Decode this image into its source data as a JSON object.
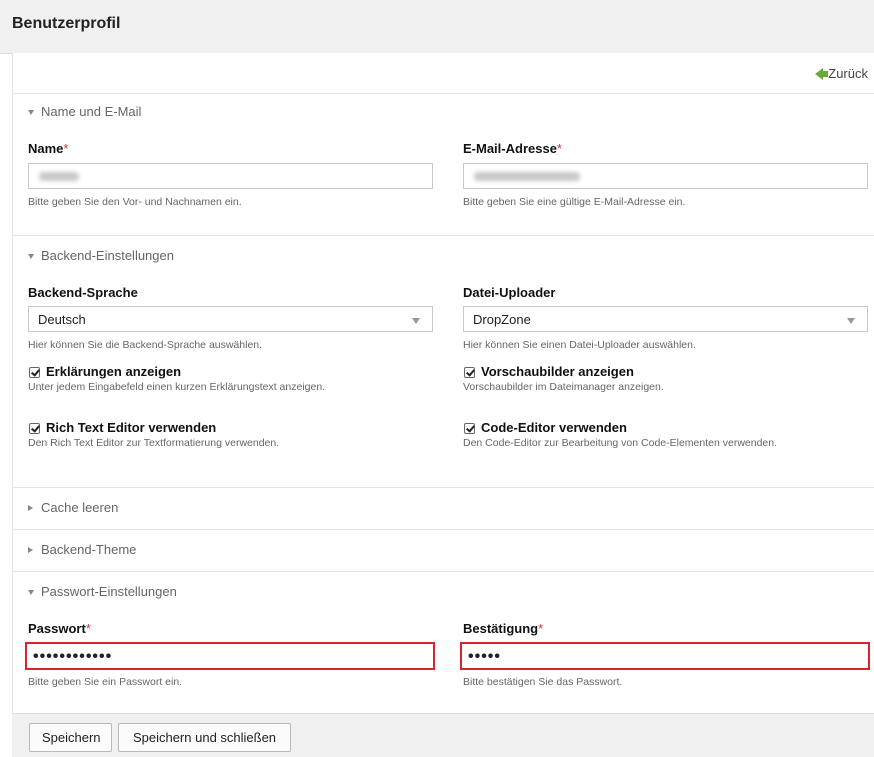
{
  "header": {
    "title": "Benutzerprofil"
  },
  "toolbar": {
    "back_label": "Zurück"
  },
  "sections": {
    "name_email": {
      "legend": "Name und E-Mail",
      "name": {
        "label": "Name",
        "required": "*",
        "hint": "Bitte geben Sie den Vor- und Nachnamen ein."
      },
      "email": {
        "label": "E-Mail-Adresse",
        "required": "*",
        "hint": "Bitte geben Sie eine gültige E-Mail-Adresse ein."
      }
    },
    "backend": {
      "legend": "Backend-Einstellungen",
      "language": {
        "label": "Backend-Sprache",
        "value": "Deutsch",
        "hint": "Hier können Sie die Backend-Sprache auswählen."
      },
      "uploader": {
        "label": "Datei-Uploader",
        "value": "DropZone",
        "hint": "Hier können Sie einen Datei-Uploader auswählen."
      },
      "explanations": {
        "label": "Erklärungen anzeigen",
        "hint": "Unter jedem Eingabefeld einen kurzen Erklärungstext anzeigen.",
        "checked": true
      },
      "thumbnails": {
        "label": "Vorschaubilder anzeigen",
        "hint": "Vorschaubilder im Dateimanager anzeigen.",
        "checked": true
      },
      "rte": {
        "label": "Rich Text Editor verwenden",
        "hint": "Den Rich Text Editor zur Textformatierung verwenden.",
        "checked": true
      },
      "code_editor": {
        "label": "Code-Editor verwenden",
        "hint": "Den Code-Editor zur Bearbeitung von Code-Elementen verwenden.",
        "checked": true
      }
    },
    "cache": {
      "legend": "Cache leeren"
    },
    "theme": {
      "legend": "Backend-Theme"
    },
    "password": {
      "legend": "Passwort-Einstellungen",
      "password": {
        "label": "Passwort",
        "required": "*",
        "value": "••••••••••••",
        "hint": "Bitte geben Sie ein Passwort ein."
      },
      "confirm": {
        "label": "Bestätigung",
        "required": "*",
        "value": "•••••",
        "hint": "Bitte bestätigen Sie das Passwort."
      }
    }
  },
  "footer": {
    "save": "Speichern",
    "save_close": "Speichern und schließen"
  },
  "colors": {
    "error_border": "#d9232d",
    "back_arrow": "#6aaa3a",
    "required": "#cc3333"
  }
}
